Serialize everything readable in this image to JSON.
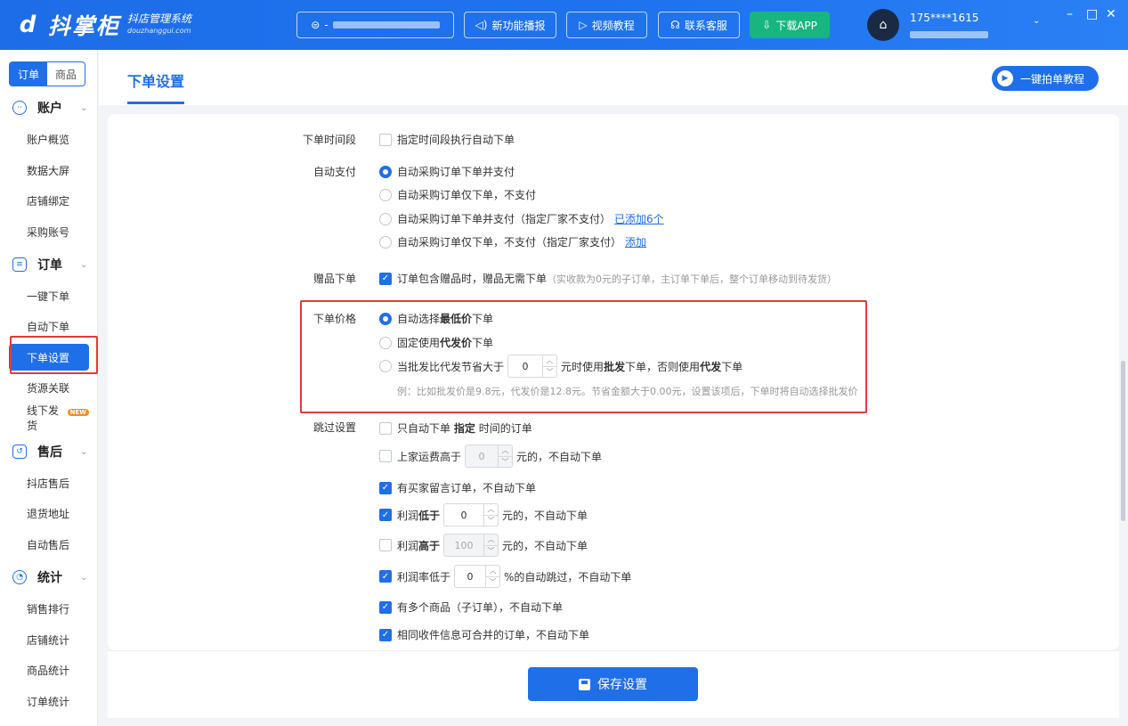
{
  "colors": {
    "brand": "#1f6fe8",
    "success": "#17b680",
    "highlight": "#e4393c"
  },
  "topbar": {
    "logo_name": "抖掌柜",
    "logo_sub_cn": "抖店管理系统",
    "logo_sub_en": "douzhanggui.com",
    "store_prefix": "-",
    "new_feature": "新功能播报",
    "video_tutorial": "视频教程",
    "contact": "联系客服",
    "download": "下载APP",
    "user_id": "175****1615"
  },
  "sidebar": {
    "seg_order": "订单",
    "seg_product": "商品",
    "groups": [
      {
        "label": "账户",
        "icon": "smile-icon",
        "items": [
          "账户概览",
          "数据大屏",
          "店铺绑定",
          "采购账号"
        ]
      },
      {
        "label": "订单",
        "icon": "list-icon",
        "items": [
          "一键下单",
          "自动下单",
          "下单设置",
          "货源关联",
          "线下发货"
        ]
      },
      {
        "label": "售后",
        "icon": "return-icon",
        "items": [
          "抖店售后",
          "退货地址",
          "自动售后"
        ]
      },
      {
        "label": "统计",
        "icon": "pie-icon",
        "items": [
          "销售排行",
          "店铺统计",
          "商品统计",
          "订单统计"
        ]
      }
    ],
    "new_badge": "NEW"
  },
  "header": {
    "tab": "下单设置",
    "tutorial": "一键拍单教程"
  },
  "settings": {
    "time_label": "下单时间段",
    "time_opt": "指定时间段执行自动下单",
    "pay_label": "自动支付",
    "pay_opts": [
      "自动采购订单下单并支付",
      "自动采购订单仅下单，不支付",
      "自动采购订单下单并支付（指定厂家不支付）",
      "自动采购订单仅下单，不支付（指定厂家支付）"
    ],
    "pay_link_added": "已添加6个",
    "pay_link_add": "添加",
    "gift_label": "赠品下单",
    "gift_opt": "订单包含赠品时，赠品无需下单",
    "gift_note": "（实收款为0元的子订单，主订单下单后，整个订单移动到待发货）",
    "price_label": "下单价格",
    "price_opt1_a": "自动选择",
    "price_opt1_b": "最低价",
    "price_opt1_c": "下单",
    "price_opt2_a": "固定使用",
    "price_opt2_b": "代发价",
    "price_opt2_c": "下单",
    "price_opt3_a": "当批发比代发节省大于",
    "price_opt3_value": "0",
    "price_opt3_b": "元时使用",
    "price_opt3_c": "批发",
    "price_opt3_d": "下单，否则使用",
    "price_opt3_e": "代发",
    "price_opt3_f": "下单",
    "price_note": "例：比如批发价是9.8元，代发价是12.8元。节省金额大于0.00元，设置该项后，下单时将自动选择批发价",
    "skip_label": "跳过设置",
    "skip1_a": "只自动下单",
    "skip1_b": "指定",
    "skip1_c": "时间的订单",
    "skip2_a": "上家运费高于",
    "skip2_value": "0",
    "skip2_b": "元的，不自动下单",
    "skip3": "有买家留言订单，不自动下单",
    "skip4_a": "利润",
    "skip4_b": "低于",
    "skip4_value": "0",
    "skip4_c": "元的，不自动下单",
    "skip5_a": "利润",
    "skip5_b": "高于",
    "skip5_value": "100",
    "skip5_c": "元的，不自动下单",
    "skip6_a": "利润率低于",
    "skip6_value": "0",
    "skip6_b": "%的自动跳过，不自动下单",
    "skip7": "有多个商品（子订单），不自动下单",
    "skip8": "相同收件信息可合并的订单，不自动下单"
  },
  "footer": {
    "save": "保存设置"
  }
}
